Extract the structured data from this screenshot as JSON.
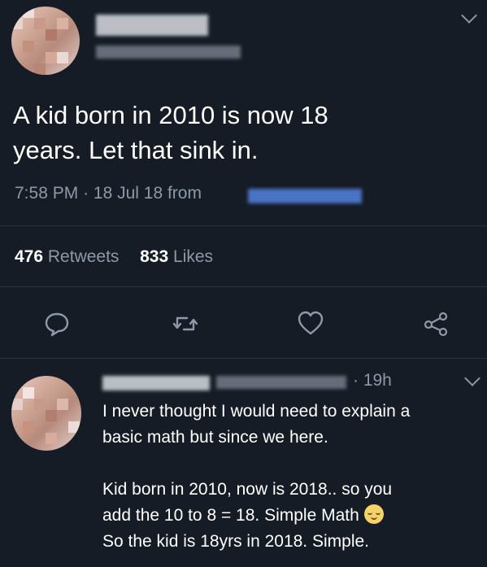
{
  "main_tweet": {
    "text_line1": "A kid born in 2010 is now 18",
    "text_line2": "years. Let that sink in.",
    "time": "7:58 PM",
    "date": "18 Jul 18",
    "from_label": "from",
    "retweets_count": "476",
    "retweets_label": "Retweets",
    "likes_count": "833",
    "likes_label": "Likes"
  },
  "actions": {
    "reply_icon": "speech-bubble-icon",
    "retweet_icon": "retweet-icon",
    "like_icon": "heart-icon",
    "share_icon": "share-icon"
  },
  "reply": {
    "time": "19h",
    "line1": "I never thought I would need to explain a",
    "line2": "basic math but since we here.",
    "line3": "Kid born in 2010, now is 2018.. so you",
    "line4": "add the 10 to 8 = 18. Simple Math",
    "line5": "So the kid is 18yrs in 2018. Simple."
  },
  "colors": {
    "background": "#151c25",
    "muted_text": "#8d99a8",
    "divider": "#2a3441"
  }
}
